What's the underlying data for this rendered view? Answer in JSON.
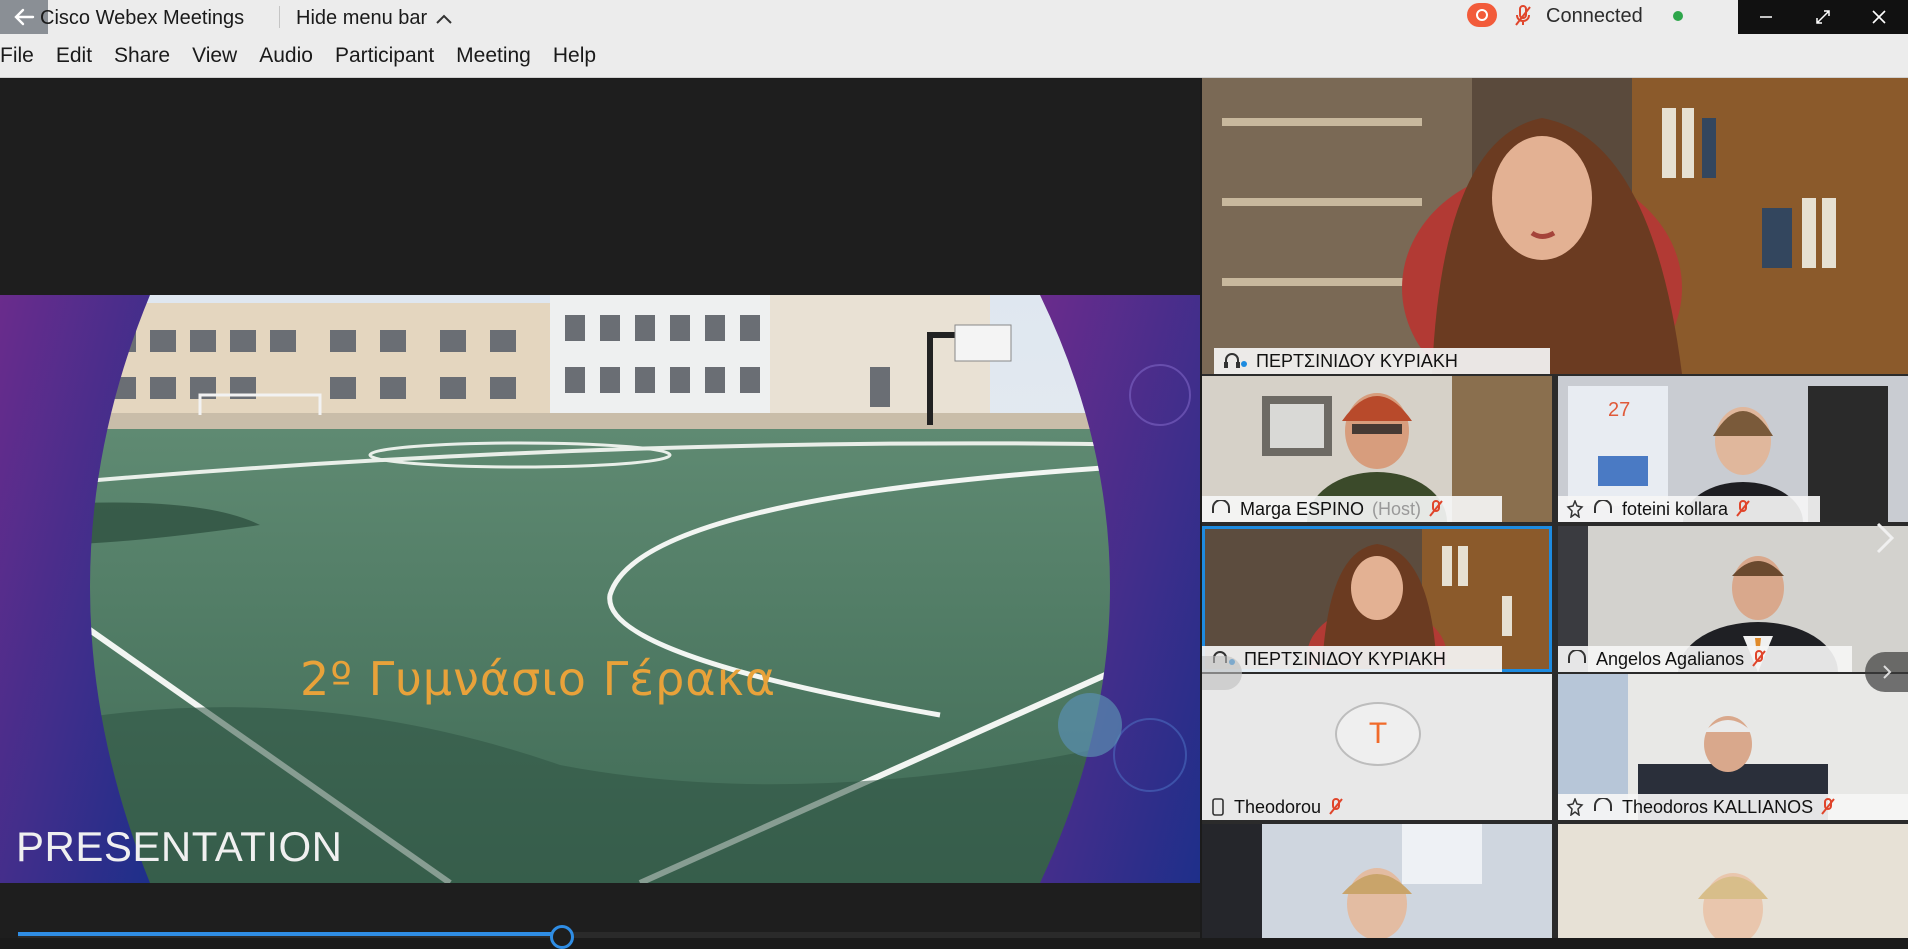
{
  "titlebar": {
    "app_title": "Cisco Webex Meetings",
    "hide_menu_label": "Hide menu bar",
    "connection_status": "Connected",
    "status_color": "#2ea64b",
    "record_color": "#f25b3a"
  },
  "menu": {
    "items": [
      "File",
      "Edit",
      "Share",
      "View",
      "Audio",
      "Participant",
      "Meeting",
      "Help"
    ]
  },
  "share": {
    "slide_caption": "2º Γυμνάσιο Γέρακα",
    "bottom_label": "PRESENTATION",
    "progress_fraction": 0.46
  },
  "participants": {
    "active_speaker": "ΠΕΡΤΣΙΝΙΔΟΥ ΚΥΡΙΑΚΗ",
    "tiles": [
      {
        "name": "Marga ESPINO",
        "role": "(Host)"
      },
      {
        "name": "foteini kollara",
        "role": ""
      },
      {
        "name": "ΠΕΡΤΣΙΝΙΔΟΥ ΚΥΡΙΑΚΗ",
        "role": ""
      },
      {
        "name": "Angelos Agalianos",
        "role": ""
      },
      {
        "name": "Theodorou",
        "role": "",
        "avatar_initial": "T"
      },
      {
        "name": "Theodoros KALLIANOS",
        "role": ""
      }
    ]
  },
  "icons": {
    "back": "arrow-left-icon",
    "hide_menu": "chevron-up-icon",
    "record": "record-icon",
    "mic": "microphone-muted-icon",
    "minimize": "minimize-icon",
    "restore": "restore-icon",
    "close": "close-icon",
    "audio": "headset-icon",
    "next": "chevron-right-icon"
  }
}
